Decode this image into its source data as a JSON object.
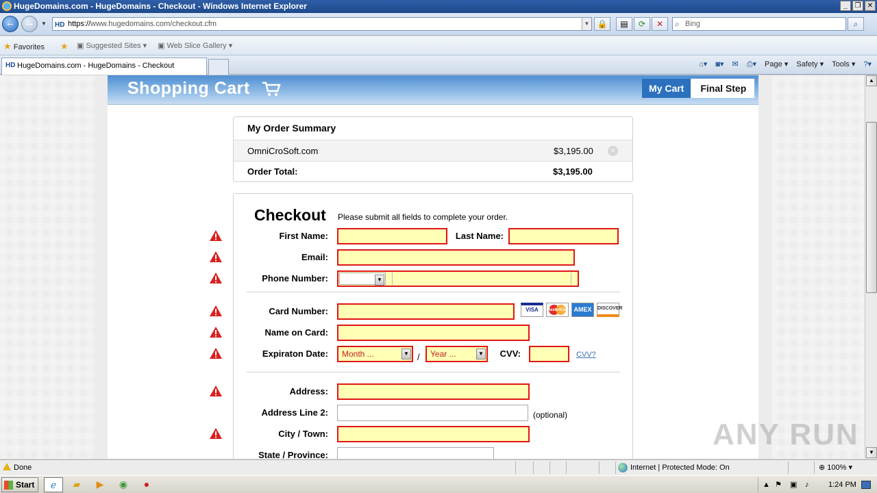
{
  "window": {
    "title": "HugeDomains.com - HugeDomains - Checkout - Windows Internet Explorer",
    "minimize": "_",
    "maximize": "❐",
    "close": "✕"
  },
  "browser": {
    "url_scheme": "https://",
    "url_rest": "www.hugedomains.com/checkout.cfm",
    "favicon_label": "HD",
    "search_placeholder": "Bing",
    "favorites_label": "Favorites",
    "suggested_sites": "Suggested Sites ▾",
    "web_slice": "Web Slice Gallery ▾",
    "tab_title": "HugeDomains.com - HugeDomains - Checkout",
    "cmd_page": "Page ▾",
    "cmd_safety": "Safety ▾",
    "cmd_tools": "Tools ▾",
    "cmd_help": "?▾"
  },
  "cart": {
    "title": "Shopping Cart",
    "step_current": "My Cart",
    "step_next": "Final Step"
  },
  "summary": {
    "heading": "My Order Summary",
    "item_name": "OmniCroSoft.com",
    "item_price": "$3,195.00",
    "remove_symbol": "×",
    "total_label": "Order Total:",
    "total_value": "$3,195.00"
  },
  "checkout": {
    "title": "Checkout",
    "subtitle": "Please submit all fields to complete your order.",
    "first_name_label": "First Name:",
    "last_name_label": "Last Name:",
    "email_label": "Email:",
    "phone_label": "Phone Number:",
    "card_number_label": "Card Number:",
    "name_on_card_label": "Name on Card:",
    "expiration_label": "Expiraton Date:",
    "month_value": "Month ...",
    "year_value": "Year ...",
    "slash": "/",
    "cvv_label": "CVV:",
    "cvv_link": "CVV?",
    "address_label": "Address:",
    "address2_label": "Address Line 2:",
    "optional": "(optional)",
    "city_label": "City / Town:",
    "state_label": "State / Province:",
    "cards": {
      "visa": "VISA",
      "mastercard": "MasterCard",
      "amex": "AMEX",
      "discover": "DISCOVER"
    }
  },
  "status": {
    "text": "Done",
    "zone": "Internet | Protected Mode: On",
    "zoom": "100%"
  },
  "taskbar": {
    "start": "Start",
    "time": "1:24 PM"
  },
  "watermark": "ANY RUN",
  "colors": {
    "error_border": "#e01515",
    "error_fill": "#ffffb5",
    "header_blue": "#4e8fd2",
    "step_blue": "#2c71be"
  }
}
